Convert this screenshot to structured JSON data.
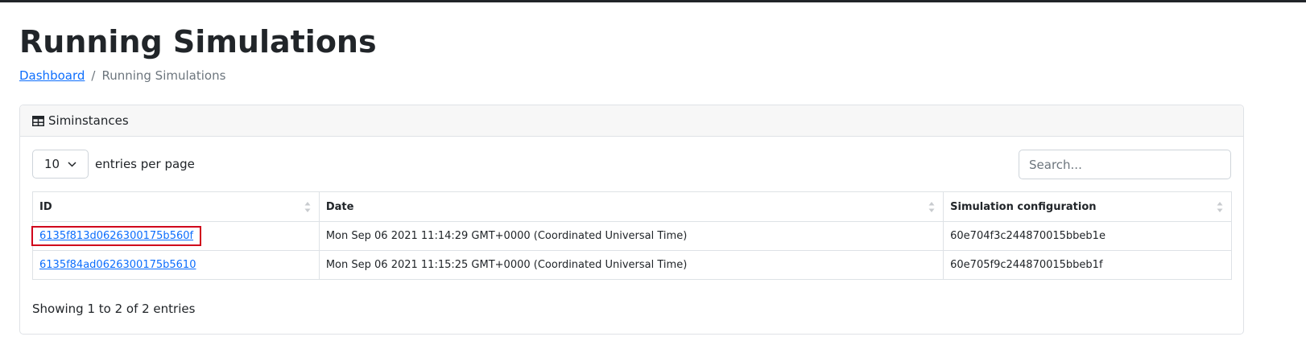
{
  "page": {
    "title": "Running Simulations"
  },
  "breadcrumb": {
    "home": "Dashboard",
    "separator": "/",
    "current": "Running Simulations"
  },
  "card": {
    "header_icon": "table-icon",
    "header_title": "Siminstances"
  },
  "controls": {
    "per_page_value": "10",
    "per_page_label": "entries per page",
    "search_placeholder": "Search..."
  },
  "table": {
    "columns": [
      "ID",
      "Date",
      "Simulation configuration"
    ],
    "rows": [
      {
        "id": "6135f813d0626300175b560f",
        "date": "Mon Sep 06 2021 11:14:29 GMT+0000 (Coordinated Universal Time)",
        "config": "60e704f3c244870015bbeb1e"
      },
      {
        "id": "6135f84ad0626300175b5610",
        "date": "Mon Sep 06 2021 11:15:25 GMT+0000 (Coordinated Universal Time)",
        "config": "60e705f9c244870015bbeb1f"
      }
    ]
  },
  "footer": {
    "info": "Showing 1 to 2 of 2 entries"
  },
  "colors": {
    "link": "#0d6efd",
    "highlight": "#d0021b",
    "text": "#212529",
    "muted": "#6c757d"
  }
}
